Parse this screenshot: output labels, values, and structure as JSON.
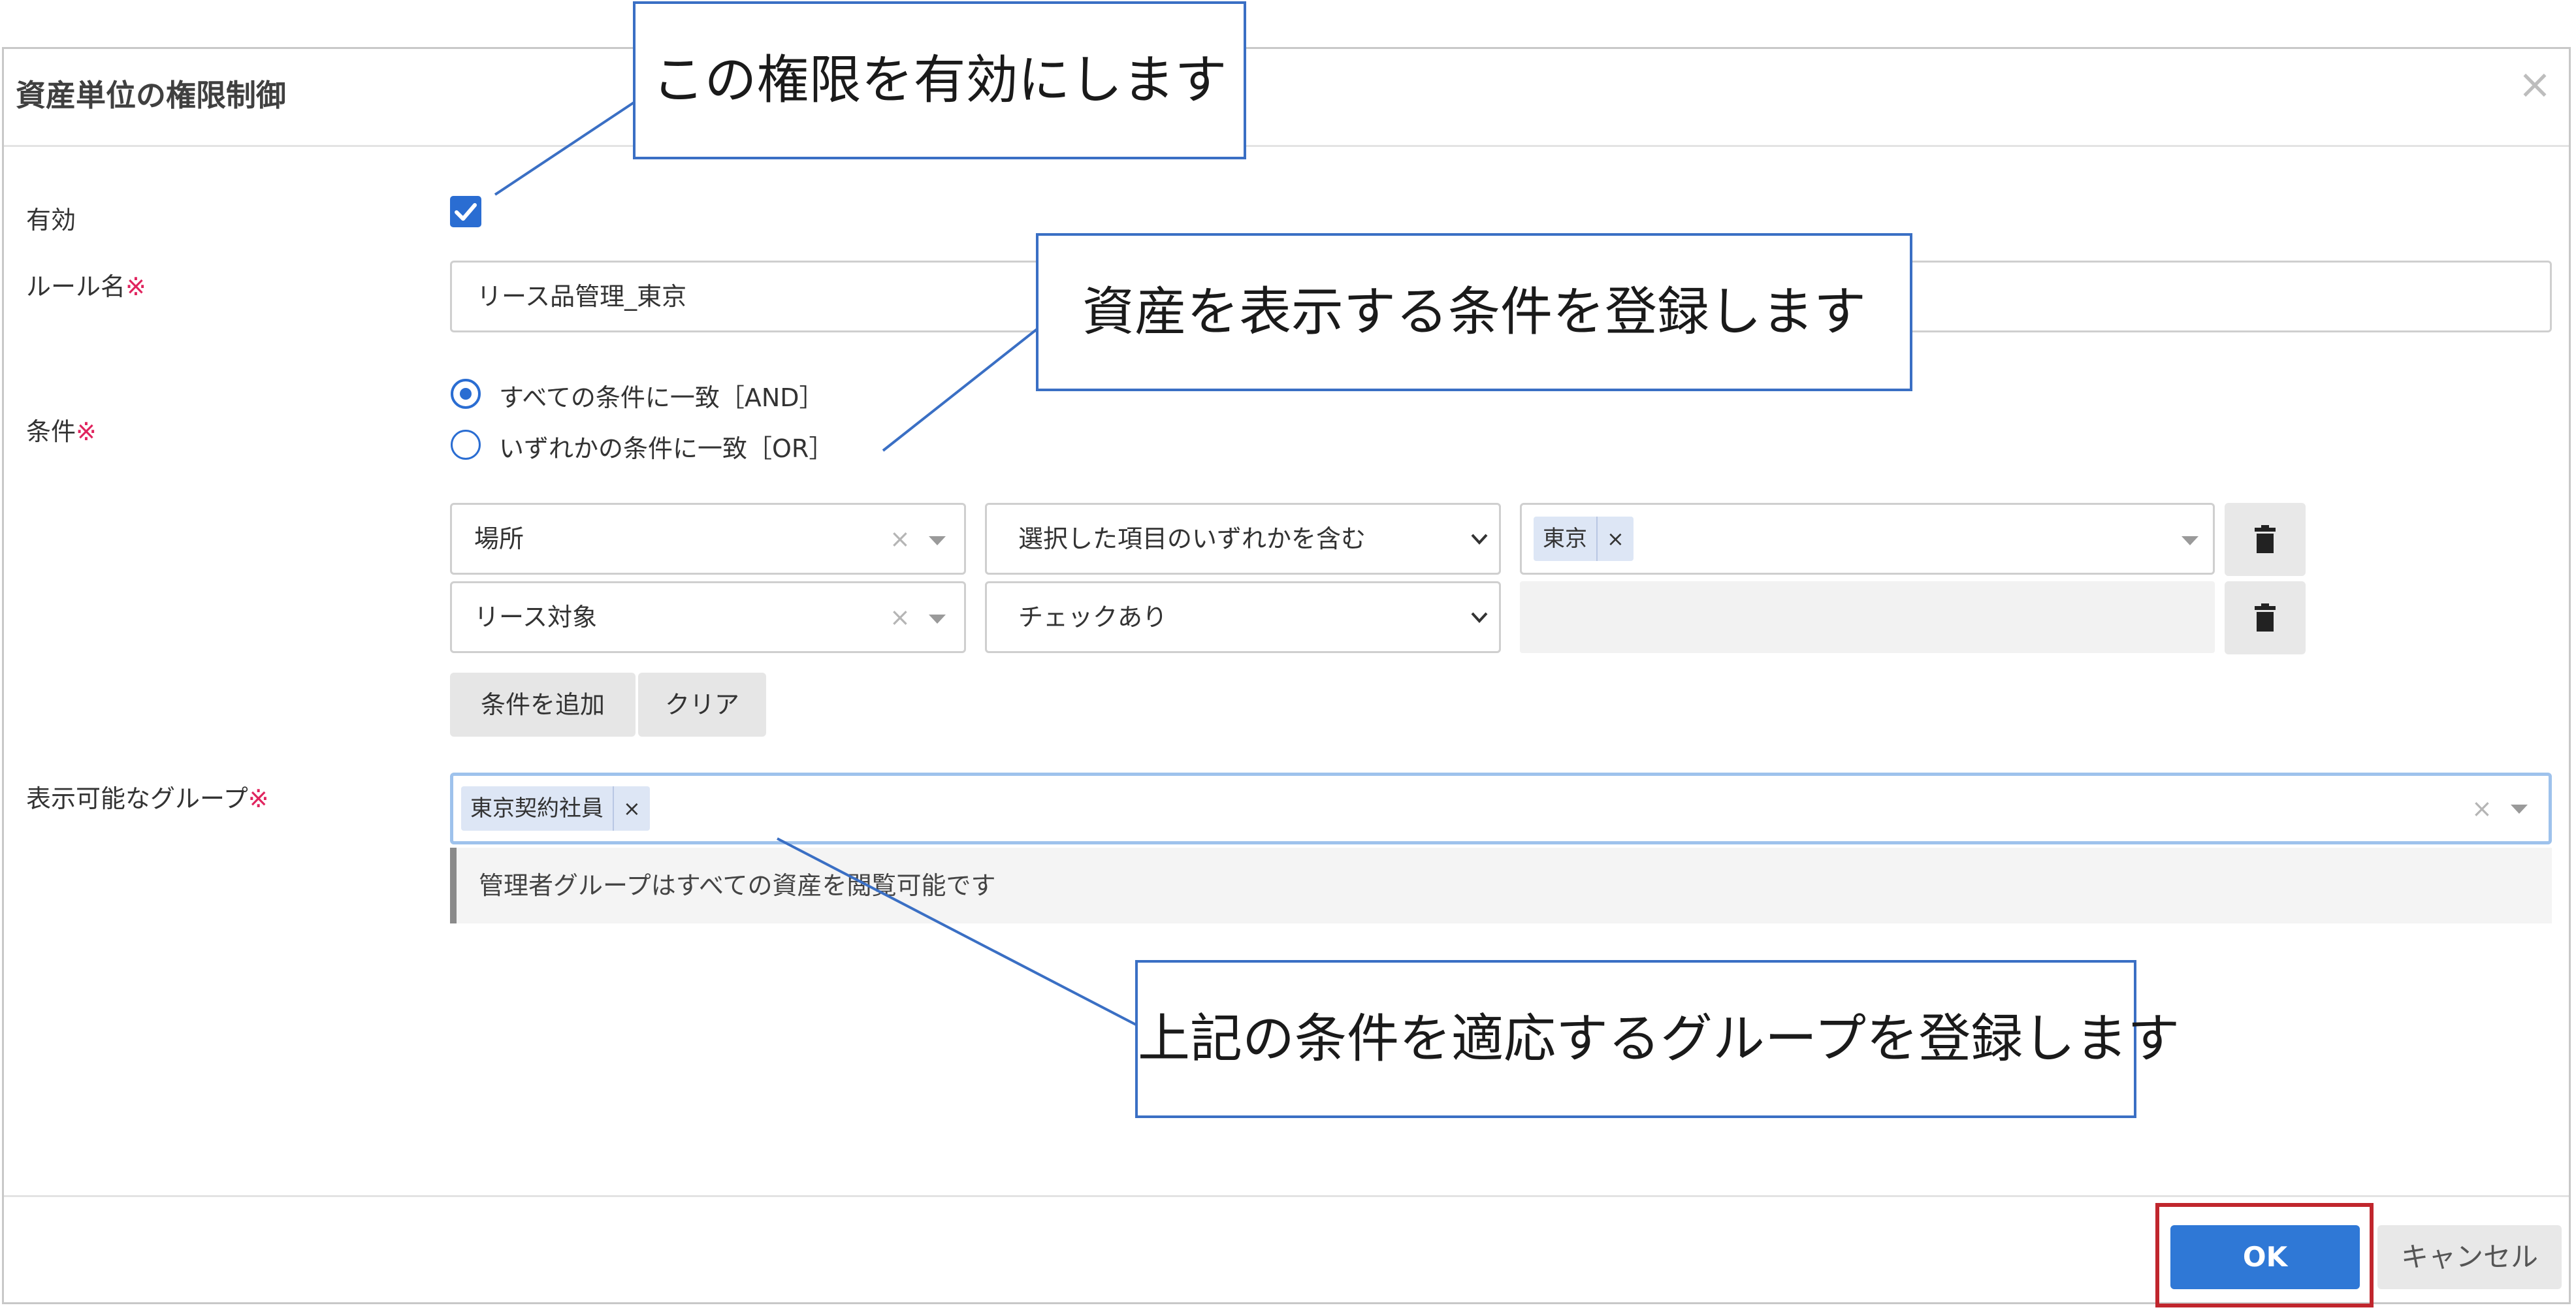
{
  "dialog": {
    "title": "資産単位の権限制御",
    "close_glyph": "×"
  },
  "form": {
    "enabled_label": "有効",
    "rule_name_label": "ルール名",
    "rule_name_value": "リース品管理_東京",
    "required_mark": "※",
    "conditions_label": "条件",
    "match_options": [
      {
        "label": "すべての条件に一致［AND］",
        "selected": true
      },
      {
        "label": "いずれかの条件に一致［OR］",
        "selected": false
      }
    ],
    "condition_rows": [
      {
        "field": "場所",
        "operator": "選択した項目のいずれかを含む",
        "value_tags": [
          "東京"
        ]
      },
      {
        "field": "リース対象",
        "operator": "チェックあり",
        "value_tags": []
      }
    ],
    "add_condition_button": "条件を追加",
    "clear_button": "クリア",
    "groups_label": "表示可能なグループ",
    "group_tags": [
      "東京契約社員"
    ],
    "groups_note": "管理者グループはすべての資産を閲覧可能です",
    "clear_glyph": "×",
    "tag_remove_glyph": "×"
  },
  "footer": {
    "ok_button": "OK",
    "cancel_button": "キャンセル"
  },
  "callouts": {
    "enable_note": "この権限を有効にします",
    "conditions_note": "資産を表示する条件を登録します",
    "groups_note": "上記の条件を適応するグループを登録します"
  },
  "colors": {
    "accent": "#2a6dd2",
    "required": "#e0245e",
    "ok_button": "#2f78d6",
    "ok_highlight_frame": "#c0262d",
    "callout_border": "#3a6fc4"
  },
  "icons": [
    "close-icon",
    "checkmark-icon",
    "clear-icon",
    "caret-down-icon",
    "chevron-down-icon",
    "trash-icon"
  ]
}
